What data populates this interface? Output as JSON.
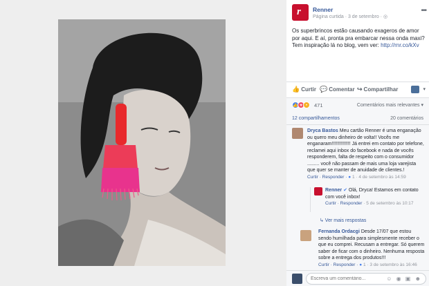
{
  "post": {
    "page_name": "Renner",
    "page_logo_letter": "r",
    "meta": "Página curtida · 3 de setembro · ◎",
    "text": "Os superbrincos estão causando exageros de amor por aqui. E aí, pronta pra embarcar nessa onda maxi? Tem inspiração lá no blog, vem ver: ",
    "link": "http://rnr.co/kXv"
  },
  "actions": {
    "like": "Curtir",
    "comment": "Comentar",
    "share": "Compartilhar"
  },
  "reactions": {
    "count": "471",
    "filter": "Comentários mais relevantes ▾",
    "shares": "12 compartilhamentos",
    "comments": "20 comentários"
  },
  "comments": [
    {
      "name": "Dryca Bastos",
      "text": "Meu cartão Renner é uma enganação ou quero meu dinheiro de volta!! Vocês me enganaram!!!!!!!!!!!!!! Já entrei em contato por telefone, reclamei aqui inbox do facebook e nada de vocês responderem, falta de respeito com o consumidor ......... você não passam de mais uma loja varejista que quer se manter de anuidade de clientes.!",
      "meta_actions": "Curtir · Responder · ",
      "meta_likes": "1",
      "meta_time": " · 4 de setembro às 14:59"
    },
    {
      "name": "Renner",
      "text": "Olá, Dryca! Estamos em contato com você inbox!",
      "meta_actions": "Curtir · Responder",
      "meta_time": " · 5 de setembro às 10:17"
    },
    {
      "name": "Fernanda Ordacgi",
      "text": "Desde 17/07 que estou sendo humilhada para simplesmente receber o que eu comprei. Recusam a entregar. Só querem saber de ficar com o dinheiro. Nenhuma resposta sobre a entrega dos produtos!!!",
      "meta_actions": "Curtir · Responder · ",
      "meta_likes": "1",
      "meta_time": " · 3 de setembro às 16:46"
    }
  ],
  "more_replies": "↳ Ver mais respostas",
  "composer": {
    "placeholder": "Escreva um comentário...",
    "icons": "☺ ◉ ▣ ☻"
  },
  "colors": {
    "brand": "#c8102e",
    "link": "#365899",
    "earring_top": "#e8292c",
    "earring_bottom": "#e8338d"
  }
}
